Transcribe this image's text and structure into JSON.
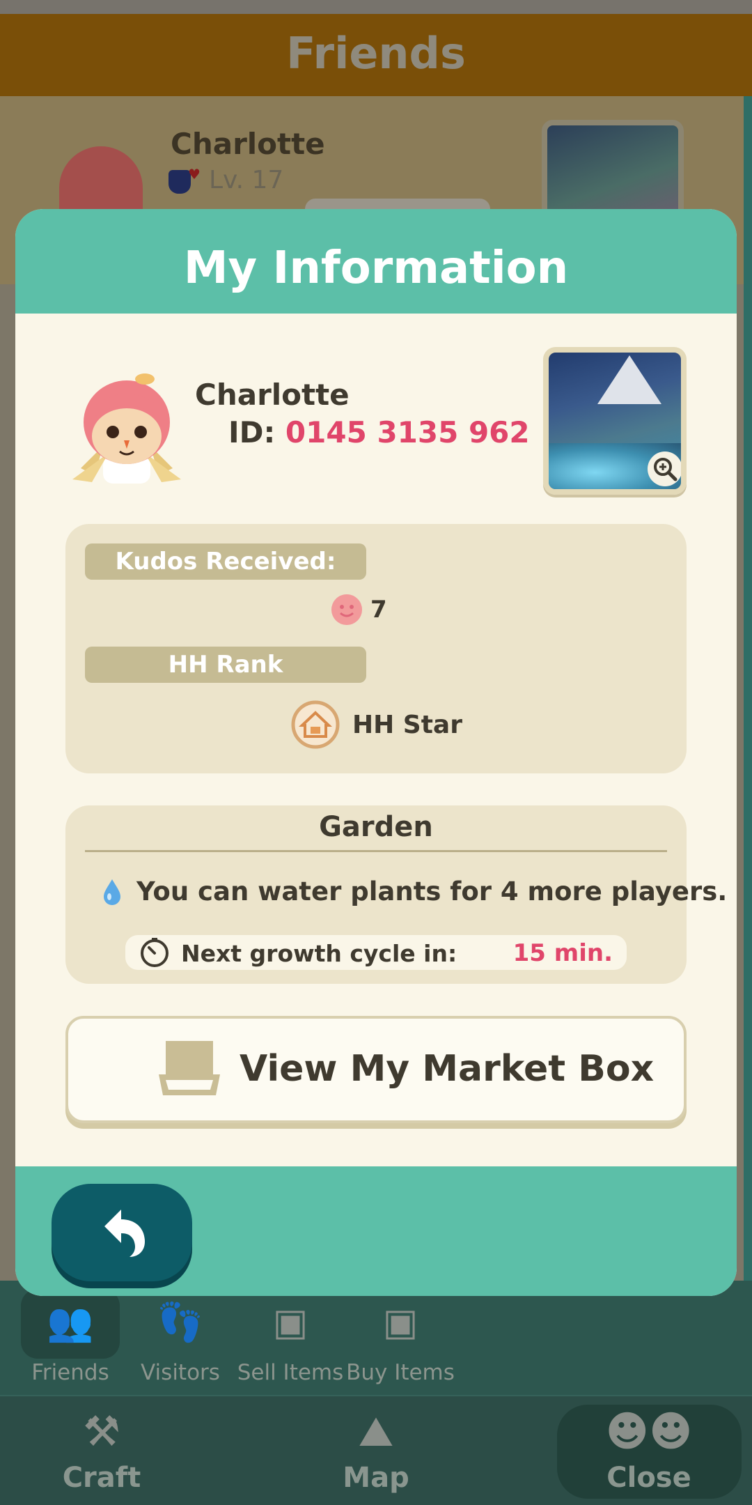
{
  "background_screen": {
    "title": "Friends",
    "friend": {
      "name": "Charlotte",
      "level": "Lv. 17"
    },
    "tabs": [
      {
        "label": "Friends",
        "icon": "friends-icon"
      },
      {
        "label": "Visitors",
        "icon": "footprints-icon"
      },
      {
        "label": "Sell Items",
        "icon": "market-box-icon"
      },
      {
        "label": "Buy Items",
        "icon": "market-box-people-icon"
      }
    ],
    "bottom_nav": [
      {
        "label": "Craft",
        "icon": "craft-tools-icon"
      },
      {
        "label": "Map",
        "icon": "map-icon"
      },
      {
        "label": "Close",
        "icon": "characters-icon"
      }
    ]
  },
  "modal": {
    "title": "My Information",
    "profile": {
      "name": "Charlotte",
      "id_label": "ID:",
      "id_value": "0145 3135 962"
    },
    "kudos": {
      "label": "Kudos Received:",
      "value": "7"
    },
    "rank": {
      "label": "HH Rank",
      "value": "HH Star"
    },
    "garden": {
      "title": "Garden",
      "water_text": "You can water plants for 4 more players.",
      "cycle_label": "Next growth cycle in:",
      "cycle_value": "15 min."
    },
    "market_button": "View My Market Box"
  },
  "colors": {
    "teal": "#5cbfa8",
    "cream": "#faf6e8",
    "accent_pink": "#e0456a",
    "back_button": "#0d5c67"
  }
}
